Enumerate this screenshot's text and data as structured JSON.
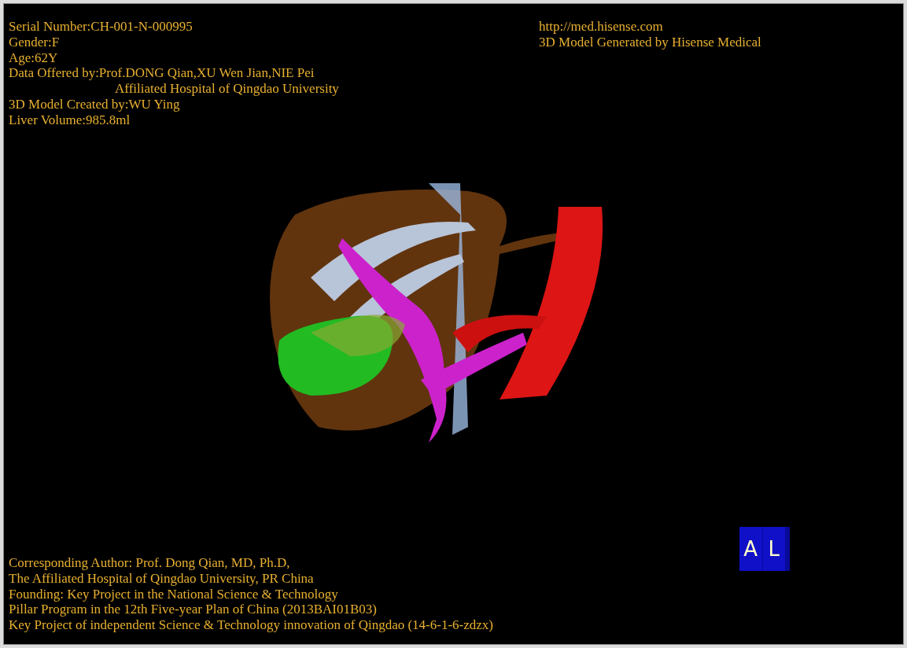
{
  "info_top_left": [
    {
      "kind": "line",
      "text": "Serial Number:CH-001-N-000995"
    },
    {
      "kind": "line",
      "text": "Gender:F"
    },
    {
      "kind": "line",
      "text": "Age:62Y"
    },
    {
      "kind": "line",
      "text": "Data Offered by:Prof.DONG Qian,XU Wen Jian,NIE Pei"
    },
    {
      "kind": "continuation",
      "text": "Affiliated Hospital of Qingdao University"
    },
    {
      "kind": "line",
      "text": "3D Model Created by:WU Ying"
    },
    {
      "kind": "line",
      "text": "Liver Volume:985.8ml"
    }
  ],
  "info_top_right": [
    "http://med.hisense.com",
    "3D Model Generated by Hisense Medical"
  ],
  "orientation_cube": {
    "faces": [
      "A",
      "L"
    ]
  },
  "info_bottom": [
    "Corresponding Author: Prof. Dong Qian, MD, Ph.D,",
    "The Affiliated Hospital of Qingdao University, PR China",
    "Founding: Key Project in the National Science & Technology",
    "Pillar Program in the 12th Five-year Plan of China (2013BAI01B03)",
    "Key Project of independent Science & Technology innovation of Qingdao (14-6-1-6-zdzx)"
  ]
}
